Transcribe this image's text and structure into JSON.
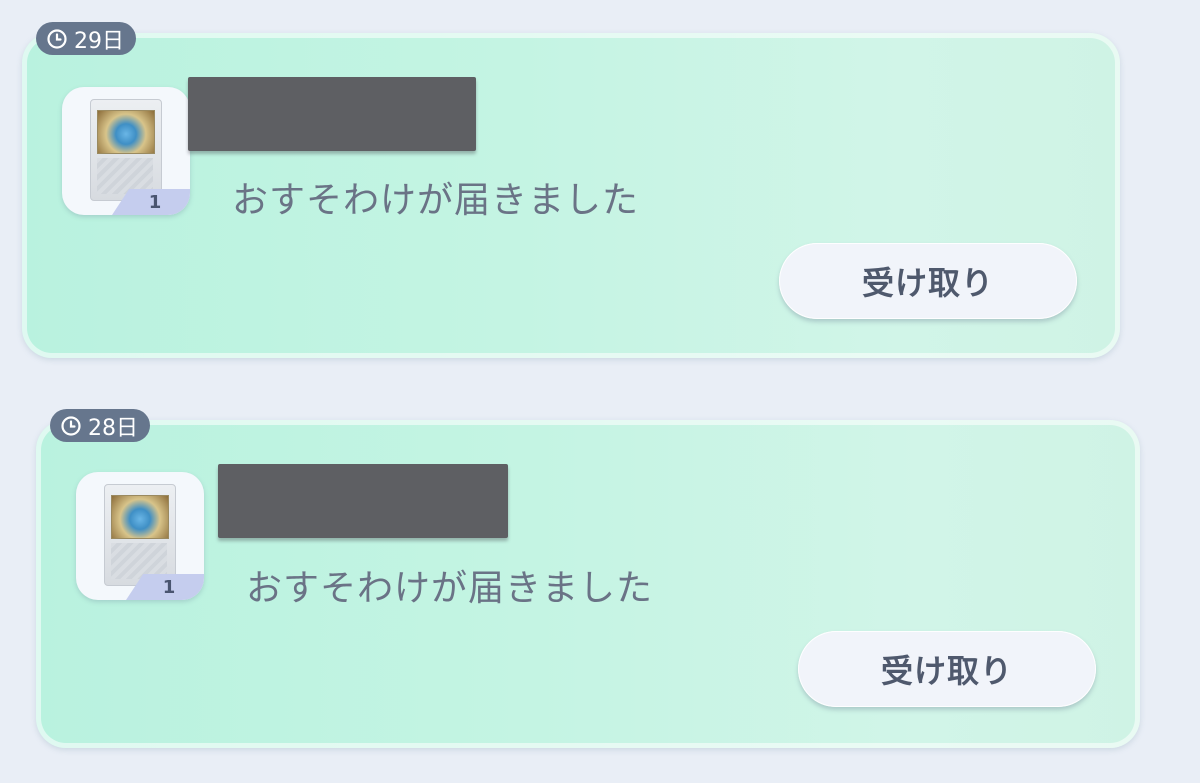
{
  "gifts": [
    {
      "expiry_days": "29日",
      "message": "おすそわけが届きました",
      "card_quantity": "1",
      "receive_button_label": "受け取り",
      "sender_name_redacted": true
    },
    {
      "expiry_days": "28日",
      "message": "おすそわけが届きました",
      "card_quantity": "1",
      "receive_button_label": "受け取り",
      "sender_name_redacted": true
    }
  ],
  "icons": {
    "expiry": "clock-icon"
  },
  "colors": {
    "card_background": "#c4f4e3",
    "expiry_pill": "#66768d",
    "button_background": "#f1f4fa",
    "message_text": "#6a7386",
    "redaction": "#5e5f63"
  }
}
